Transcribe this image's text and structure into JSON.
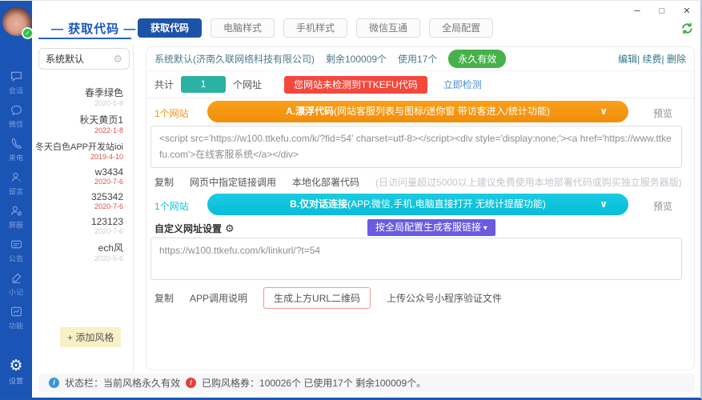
{
  "header": {
    "title": "— 获取代码 —",
    "tabs": [
      {
        "label": "获取代码"
      },
      {
        "label": "电脑样式"
      },
      {
        "label": "手机样式"
      },
      {
        "label": "微信互通"
      },
      {
        "label": "全局配置"
      }
    ]
  },
  "rail": {
    "items": [
      {
        "label": "会话"
      },
      {
        "label": "微信"
      },
      {
        "label": "来电"
      },
      {
        "label": "留言"
      },
      {
        "label": "屏蔽"
      },
      {
        "label": "公告"
      },
      {
        "label": "小记"
      },
      {
        "label": "功能"
      }
    ],
    "settings_label": "设置"
  },
  "style_panel": {
    "selected_name": "系统默认",
    "items": [
      {
        "name": "春季绿色",
        "date": "2020-1-8",
        "date_color": "gray"
      },
      {
        "name": "秋天黄页1",
        "date": "2022-1-8",
        "date_color": "red"
      },
      {
        "name": "冬天白色APP开发站ioi",
        "date": "2019-4-10",
        "date_color": "red"
      },
      {
        "name": "w3434",
        "date": "2020-7-6",
        "date_color": "red"
      },
      {
        "name": "325342",
        "date": "2020-7-6",
        "date_color": "red"
      },
      {
        "name": "123123",
        "date": "2020-7-6",
        "date_color": "gray"
      },
      {
        "name": "ech风",
        "date": "2020-5-6",
        "date_color": "gray"
      }
    ],
    "add_button": "+ 添加风格"
  },
  "account": {
    "name": "系统默认(济南久联网络科技有限公司)",
    "remaining": "剩余100009个",
    "used": "使用17个",
    "badge": "永久有效",
    "actions": "编辑| 续费| 删除"
  },
  "detect": {
    "prefix": "共计",
    "count": "1",
    "suffix": "个网址",
    "warning": "您网站未检测到TTKEFU代码",
    "action": "立即检测"
  },
  "section_a": {
    "site_count": "1个网站",
    "pill_bold": "A.漂浮代码",
    "pill_rest": "(网站客服列表与图标/迷你窗 带访客进入/统计功能)",
    "preview": "预览",
    "code": "<script src='https://w100.ttkefu.com/k/?fid=54'  charset=utf-8></script><div style='display:none;'><a href='https://www.ttkefu.com'>在线客服系统</a></div>",
    "link_copy": "复制",
    "link_specified": "网页中指定链接调用",
    "link_local": "本地化部署代码",
    "note": "(日访问量超过5000以上建议免费使用本地部署代码或购买独立服务器版)"
  },
  "section_b": {
    "site_count": "1个网站",
    "pill_bold": "B.仅对话连接",
    "pill_rest": "(APP,微信,手机,电脑直接打开 无统计提醒功能)",
    "preview": "预览",
    "custom_label": "自定义网址设置",
    "purple_button": "按全局配置生成客服链接",
    "url": "https://w100.ttkefu.com/k/linkurl/?t=54",
    "link_copy": "复制",
    "link_app": "APP调用说明",
    "link_qr": "生成上方URL二维码",
    "link_upload": "上传公众号小程序验证文件"
  },
  "status_bar": {
    "part1": "状态栏：当前风格永久有效",
    "part2": "已购风格券：100026个 已使用17个 剩余100009个。"
  },
  "colors": {
    "rail_blue": "#1a54b4",
    "active_tab_blue": "#1d53a6",
    "valid_green": "#46b14b",
    "warn_red": "#f4483c",
    "count_teal": "#2bb2a3",
    "pill_orange": "#f79410",
    "pill_cyan": "#12c3dc",
    "purple": "#6b5be0",
    "date_red": "#e0504a"
  }
}
